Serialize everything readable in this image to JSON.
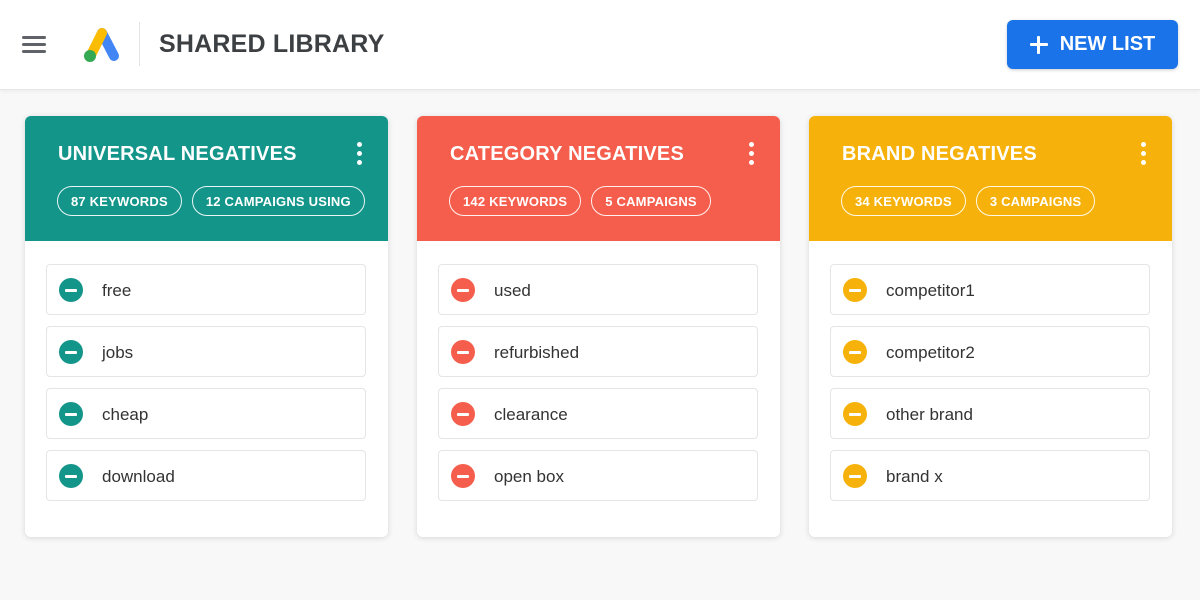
{
  "header": {
    "title": "SHARED LIBRARY",
    "new_list_label": "NEW LIST"
  },
  "colors": {
    "primary_button": "#1a73e8",
    "universal": "#14958a",
    "category": "#f55e4c",
    "brand": "#f6b20a"
  },
  "icons": {
    "menu": "menu-icon",
    "logo": "google-ads-logo",
    "plus": "plus-icon",
    "more": "more-vertical-icon",
    "remove": "minus-circle-icon"
  },
  "lists": [
    {
      "title": "UNIVERSAL NEGATIVES",
      "color": "#14958a",
      "keywords_badge": "87 KEYWORDS",
      "campaigns_badge": "12 CAMPAIGNS USING",
      "keywords": [
        "free",
        "jobs",
        "cheap",
        "download"
      ]
    },
    {
      "title": "CATEGORY NEGATIVES",
      "color": "#f55e4c",
      "keywords_badge": "142 KEYWORDS",
      "campaigns_badge": "5 CAMPAIGNS",
      "keywords": [
        "used",
        "refurbished",
        "clearance",
        "open box"
      ]
    },
    {
      "title": "BRAND NEGATIVES",
      "color": "#f6b20a",
      "keywords_badge": "34 KEYWORDS",
      "campaigns_badge": "3 CAMPAIGNS",
      "keywords": [
        "competitor1",
        "competitor2",
        "other brand",
        "brand x"
      ]
    }
  ]
}
